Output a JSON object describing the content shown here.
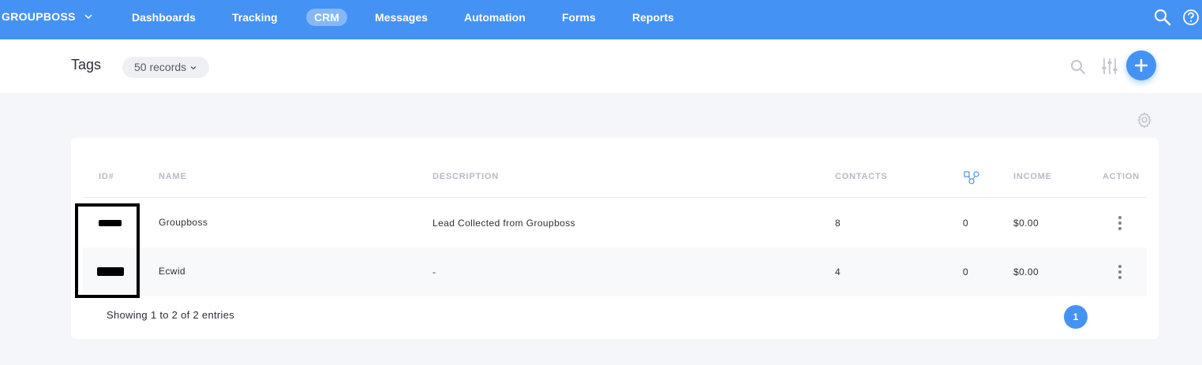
{
  "nav": {
    "brand": "GROUPBOSS",
    "items": [
      {
        "label": "Dashboards",
        "active": false
      },
      {
        "label": "Tracking",
        "active": false
      },
      {
        "label": "CRM",
        "active": true
      },
      {
        "label": "Messages",
        "active": false
      },
      {
        "label": "Automation",
        "active": false
      },
      {
        "label": "Forms",
        "active": false
      },
      {
        "label": "Reports",
        "active": false
      }
    ],
    "icons": [
      "search-icon",
      "help-icon"
    ]
  },
  "header": {
    "title": "Tags",
    "records_label": "50 records"
  },
  "table": {
    "columns": {
      "id": "ID#",
      "name": "NAME",
      "description": "DESCRIPTION",
      "contacts": "CONTACTS",
      "connections_icon": "nodes-icon",
      "income": "INCOME",
      "action": "ACTION"
    },
    "rows": [
      {
        "name": "Groupboss",
        "description": "Lead Collected from Groupboss",
        "contacts": "8",
        "connections": "0",
        "income": "$0.00"
      },
      {
        "name": "Ecwid",
        "description": "-",
        "contacts": "4",
        "connections": "0",
        "income": "$0.00"
      }
    ]
  },
  "footer": {
    "entries_text": "Showing 1 to 2 of 2 entries",
    "current_page": "1"
  },
  "colors": {
    "accent": "#4592f5",
    "background": "#f5f6fa"
  }
}
